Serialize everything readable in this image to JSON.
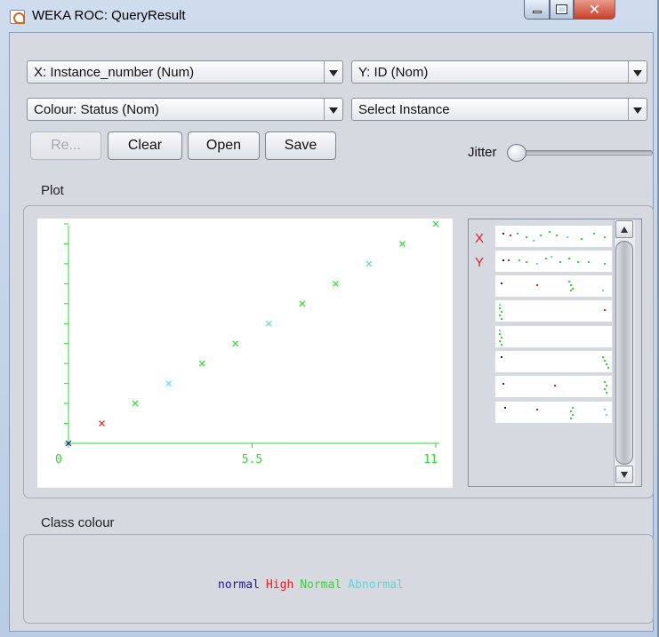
{
  "window": {
    "title": "WEKA ROC: QueryResult"
  },
  "controls": {
    "x_axis": "X: Instance_number (Num)",
    "y_axis": "Y: ID (Nom)",
    "colour": "Colour: Status (Nom)",
    "select": "Select Instance",
    "buttons": {
      "reset": "Re...",
      "clear": "Clear",
      "open": "Open",
      "save": "Save"
    },
    "jitter_label": "Jitter",
    "jitter_value": 0
  },
  "plot": {
    "label": "Plot",
    "x_ticks": [
      "0",
      "5.5",
      "11"
    ],
    "attr_labels": {
      "x": "X",
      "y": "Y"
    }
  },
  "chart_data": {
    "type": "scatter",
    "xlim": [
      0,
      11
    ],
    "ylim": [
      0,
      11
    ],
    "marker": "x",
    "points": [
      {
        "x": 0,
        "y": 0,
        "class": "normal"
      },
      {
        "x": 1,
        "y": 1,
        "class": "High"
      },
      {
        "x": 2,
        "y": 2,
        "class": "Normal"
      },
      {
        "x": 3,
        "y": 3,
        "class": "Abnormal"
      },
      {
        "x": 4,
        "y": 4,
        "class": "Normal"
      },
      {
        "x": 5,
        "y": 5,
        "class": "Normal"
      },
      {
        "x": 6,
        "y": 6,
        "class": "Abnormal"
      },
      {
        "x": 7,
        "y": 7,
        "class": "Normal"
      },
      {
        "x": 8,
        "y": 8,
        "class": "Normal"
      },
      {
        "x": 9,
        "y": 9,
        "class": "Abnormal"
      },
      {
        "x": 10,
        "y": 10,
        "class": "Normal"
      },
      {
        "x": 11,
        "y": 11,
        "class": "Normal"
      }
    ],
    "x_tick_labels": [
      "0",
      "5.5",
      "11"
    ]
  },
  "class_colour": {
    "label": "Class colour",
    "classes": [
      {
        "name": "normal",
        "color": "#1a1aa6"
      },
      {
        "name": "High",
        "color": "#e02020"
      },
      {
        "name": "Normal",
        "color": "#2bdc2b"
      },
      {
        "name": "Abnormal",
        "color": "#5ad8dc"
      }
    ]
  },
  "colors": {
    "axis": "#2bdc2b",
    "accent_red": "#e02020"
  }
}
